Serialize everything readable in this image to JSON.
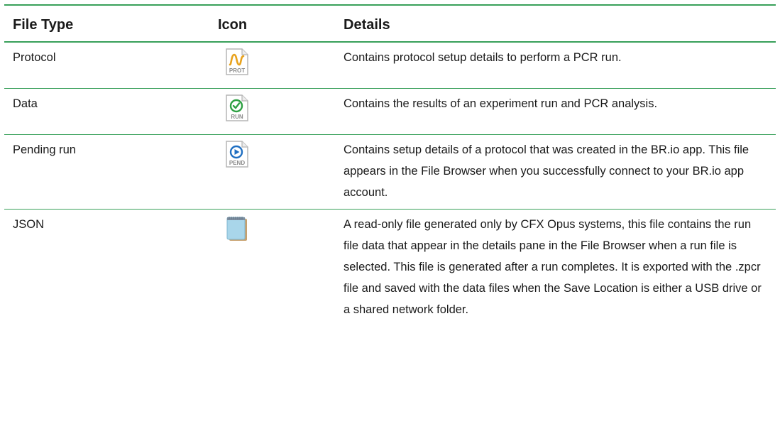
{
  "table": {
    "headers": {
      "file_type": "File Type",
      "icon": "Icon",
      "details": "Details"
    },
    "rows": [
      {
        "file_type": "Protocol",
        "icon": "protocol-file-icon",
        "icon_label": "PROT",
        "details": "Contains protocol setup details to perform a PCR run."
      },
      {
        "file_type": "Data",
        "icon": "run-data-file-icon",
        "icon_label": "RUN",
        "details": "Contains the results of an experiment run and PCR analysis."
      },
      {
        "file_type": "Pending run",
        "icon": "pending-run-file-icon",
        "icon_label": "PEND",
        "details": "Contains setup details of a protocol that was created in the BR.io app. This file appears in the File Browser when you successfully connect to your BR.io app account."
      },
      {
        "file_type": "JSON",
        "icon": "notepad-icon",
        "details": "A read-only file generated only by CFX Opus systems, this file contains the run file data that appear in the details pane in the File Browser when a run file is selected. This file is generated after a run completes. It is exported with the .zpcr file and saved with the data files when the Save Location is either a USB drive or a shared network folder."
      }
    ]
  },
  "colors": {
    "rule": "#38a05a",
    "prot_accent": "#e8a21c",
    "run_accent": "#2ea043",
    "pend_accent": "#1f6fc2",
    "icon_label": "#8a8a8a"
  }
}
